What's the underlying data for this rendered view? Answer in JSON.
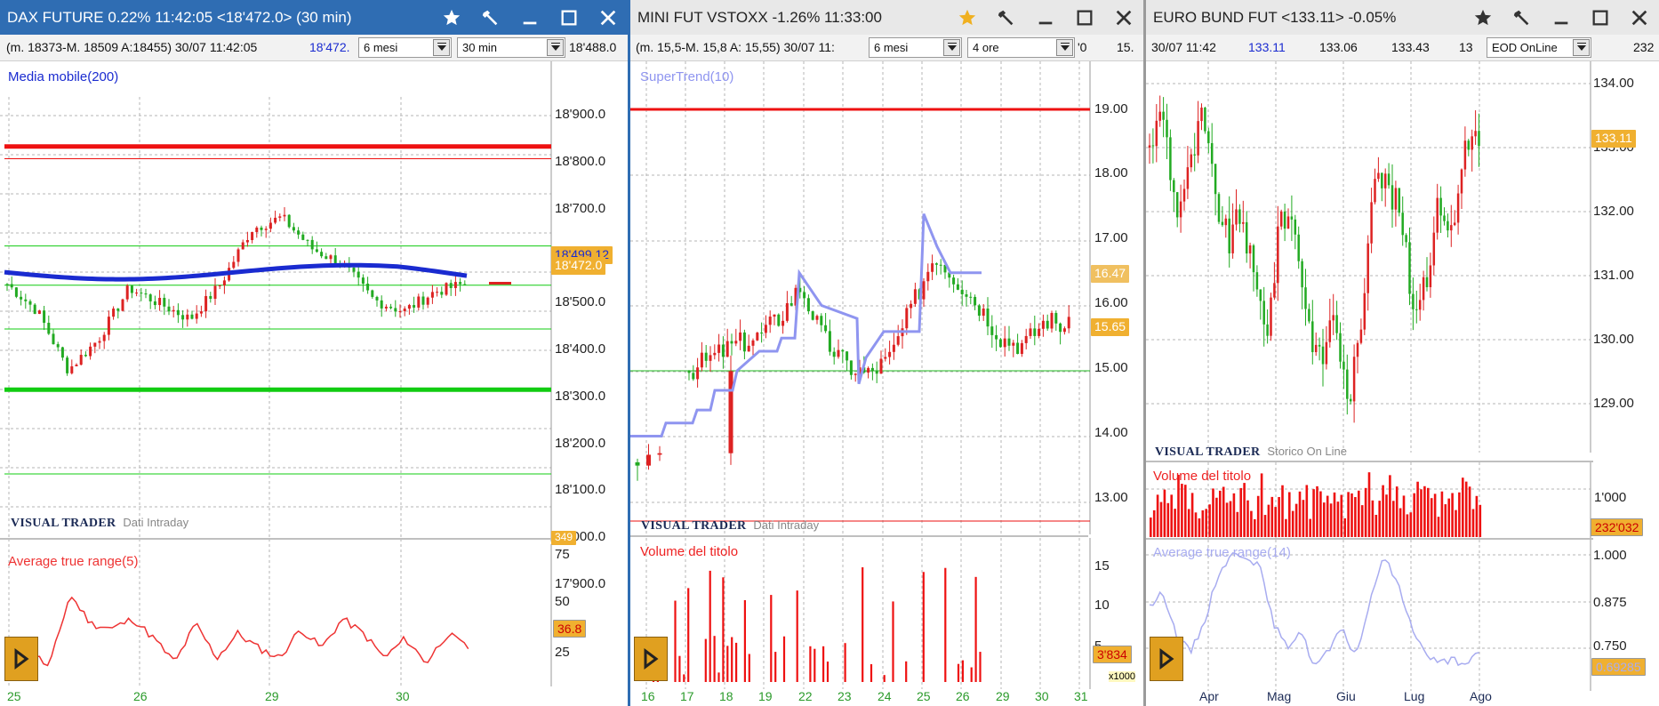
{
  "windows": [
    {
      "title": "DAX FUTURE 0.22% 11:42:05  <18'472.0> (30 min)",
      "info": {
        "left": "(m. 18373-M. 18509 A:18455) 30/07 11:42:05",
        "price": "18'472.",
        "range_select": "6 mesi",
        "interval_select": "30 min",
        "right": "18'488.0"
      },
      "indicator_label": "Media mobile(200)",
      "brand": "VISUAL TRADER",
      "brand_sub": "Dati Intraday",
      "y_labels": [
        "18'900.0",
        "18'800.0",
        "18'700.0",
        "18'600.0",
        "18'500.0",
        "18'400.0",
        "18'300.0",
        "18'200.0",
        "18'100.0",
        "18'000.0",
        "17'900.0"
      ],
      "price_tag": "18'472.0",
      "ma_tag": "18'499.12",
      "tiny_tag": "349",
      "sub_label": "Average true range(5)",
      "sub_y_labels": [
        "75",
        "50",
        "25"
      ],
      "sub_tag": "36.8",
      "x_labels": [
        "25",
        "26",
        "29",
        "30"
      ],
      "colors": {
        "up": "#22aa22",
        "down": "#dd2222",
        "ma": "#1a2bd0",
        "atr": "#ee3333"
      }
    },
    {
      "title": "MINI FUT VSTOXX -1.26% 11:33:00",
      "info": {
        "left": "(m. 15,5-M. 15,8 A: 15,55) 30/07 11:",
        "range_select": "6 mesi",
        "interval_select": "4 ore",
        "right1": "'0",
        "right2": "15."
      },
      "indicator_label": "SuperTrend(10)",
      "brand": "VISUAL TRADER",
      "brand_sub": "Dati Intraday",
      "y_labels": [
        "19.00",
        "18.00",
        "17.00",
        "16.00",
        "15.00",
        "14.00",
        "13.00"
      ],
      "price_tag": "15.65",
      "st_tag": "16.47",
      "sub_label": "Volume del titolo",
      "sub_y_labels": [
        "15",
        "10",
        "5"
      ],
      "sub_tag": "3'834",
      "x1000": "x1000",
      "x_labels": [
        "16",
        "17",
        "18",
        "19",
        "22",
        "23",
        "24",
        "25",
        "26",
        "29",
        "30",
        "31"
      ],
      "colors": {
        "supertrend": "#8f95f0"
      }
    },
    {
      "title": "EURO BUND FUT <133.11> -0.05%",
      "info": {
        "date": "30/07 11:42",
        "price": "133.11",
        "v2": "133.06",
        "v3": "133.43",
        "v4": "13",
        "select": "EOD OnLine",
        "right": "232"
      },
      "brand": "VISUAL TRADER",
      "brand_sub": "Storico On Line",
      "y_labels": [
        "134.00",
        "133.00",
        "132.00",
        "131.00",
        "130.00",
        "129.00"
      ],
      "price_tag": "133.11",
      "vol_label": "Volume del titolo",
      "vol_y_label": "1'000",
      "vol_tag": "232'032",
      "atr_label": "Average true range(14)",
      "atr_y_labels": [
        "1.000",
        "0.875",
        "0.750"
      ],
      "atr_tag": "0.69285",
      "x_labels": [
        "Apr",
        "Mag",
        "Giu",
        "Lug",
        "Ago"
      ]
    }
  ]
}
